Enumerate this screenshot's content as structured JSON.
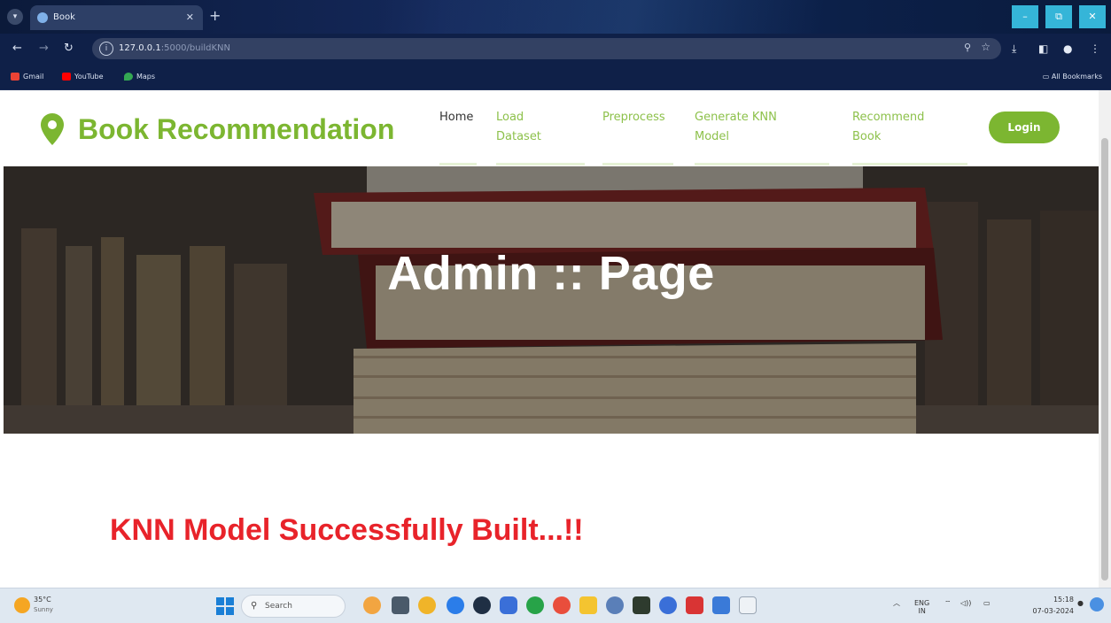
{
  "browser": {
    "tab_title": "Book",
    "url_host": "127.0.0.1",
    "url_rest": ":5000/buildKNN",
    "bookmarks": [
      "Gmail",
      "YouTube",
      "Maps"
    ],
    "all_bookmarks": "All Bookmarks",
    "window_controls": {
      "minimize": "–",
      "maximize": "⧉",
      "close": "✕"
    }
  },
  "site": {
    "brand": "Book Recommendation",
    "nav": [
      {
        "label": "Home"
      },
      {
        "label": "Load Dataset"
      },
      {
        "label": "Preprocess"
      },
      {
        "label": "Generate KNN Model"
      },
      {
        "label": "Recommend Book"
      }
    ],
    "login_label": "Login",
    "hero_title": "Admin :: Page",
    "message": "KNN Model Successfully Built...!!"
  },
  "taskbar": {
    "weather_temp": "35°C",
    "weather_desc": "Sunny",
    "search_label": "Search",
    "lang": "ENG",
    "lang_region": "IN",
    "time": "15:18",
    "date": "07-03-2024"
  },
  "colors": {
    "brand_green": "#7cb631",
    "nav_green": "#8dc14b",
    "message_red": "#e8232a"
  }
}
